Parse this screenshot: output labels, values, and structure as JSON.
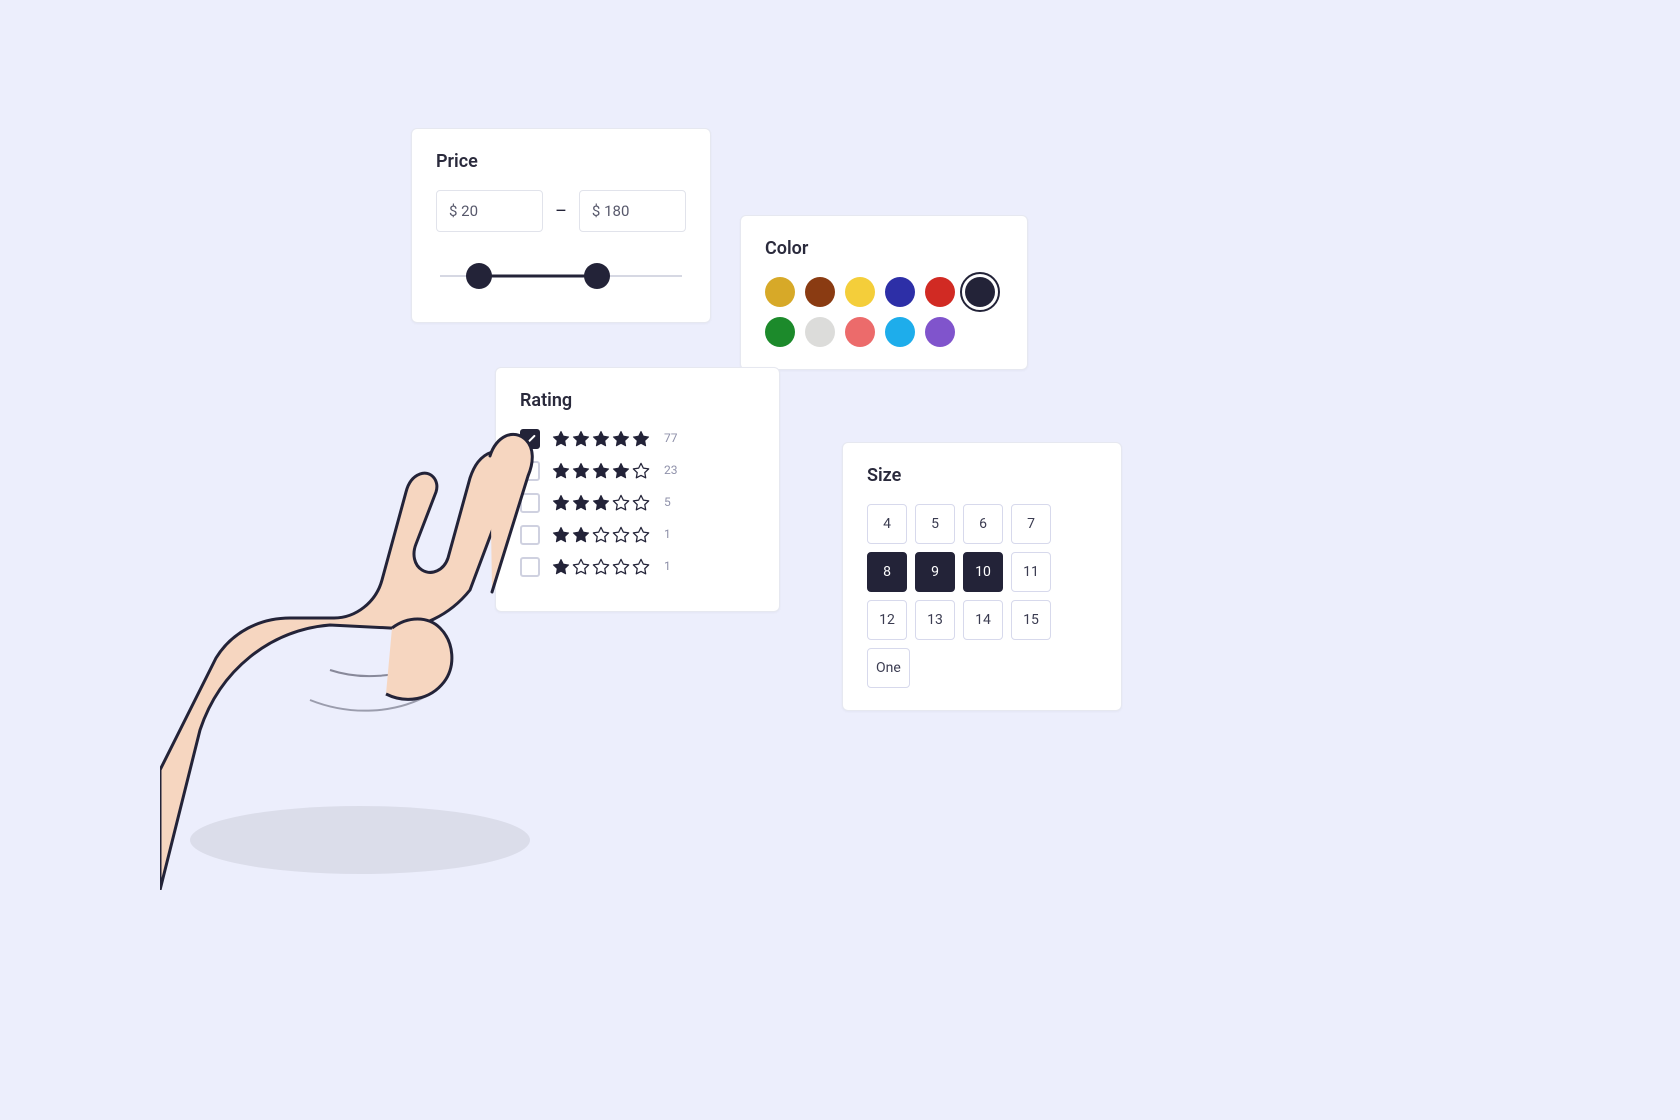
{
  "price": {
    "title": "Price",
    "currency": "$",
    "min": "20",
    "max": "180",
    "dash": "–",
    "handle_lo_pct": 16,
    "handle_hi_pct": 65
  },
  "color": {
    "title": "Color",
    "swatches": [
      {
        "name": "gold",
        "hex": "#D7A928",
        "selected": false
      },
      {
        "name": "brown",
        "hex": "#8A3B12",
        "selected": false
      },
      {
        "name": "yellow",
        "hex": "#F4CE3A",
        "selected": false
      },
      {
        "name": "indigo",
        "hex": "#2D2FA7",
        "selected": false
      },
      {
        "name": "red",
        "hex": "#D12A23",
        "selected": false
      },
      {
        "name": "dark",
        "hex": "#232338",
        "selected": true
      },
      {
        "name": "green",
        "hex": "#1C8A2B",
        "selected": false
      },
      {
        "name": "silver",
        "hex": "#DCDCDA",
        "selected": false
      },
      {
        "name": "coral",
        "hex": "#EC6B6B",
        "selected": false
      },
      {
        "name": "sky",
        "hex": "#1EADEB",
        "selected": false
      },
      {
        "name": "violet",
        "hex": "#8054CC",
        "selected": false
      }
    ]
  },
  "rating": {
    "title": "Rating",
    "rows": [
      {
        "filled": 5,
        "count": "77",
        "checked": true
      },
      {
        "filled": 4,
        "count": "23",
        "checked": false
      },
      {
        "filled": 3,
        "count": "5",
        "checked": false
      },
      {
        "filled": 2,
        "count": "1",
        "checked": false
      },
      {
        "filled": 1,
        "count": "1",
        "checked": false
      }
    ]
  },
  "size": {
    "title": "Size",
    "options": [
      {
        "label": "4",
        "selected": false
      },
      {
        "label": "5",
        "selected": false
      },
      {
        "label": "6",
        "selected": false
      },
      {
        "label": "7",
        "selected": false
      },
      {
        "label": "8",
        "selected": true
      },
      {
        "label": "9",
        "selected": true
      },
      {
        "label": "10",
        "selected": true
      },
      {
        "label": "11",
        "selected": false
      },
      {
        "label": "12",
        "selected": false
      },
      {
        "label": "13",
        "selected": false
      },
      {
        "label": "14",
        "selected": false
      },
      {
        "label": "15",
        "selected": false
      },
      {
        "label": "One",
        "selected": false
      }
    ]
  }
}
